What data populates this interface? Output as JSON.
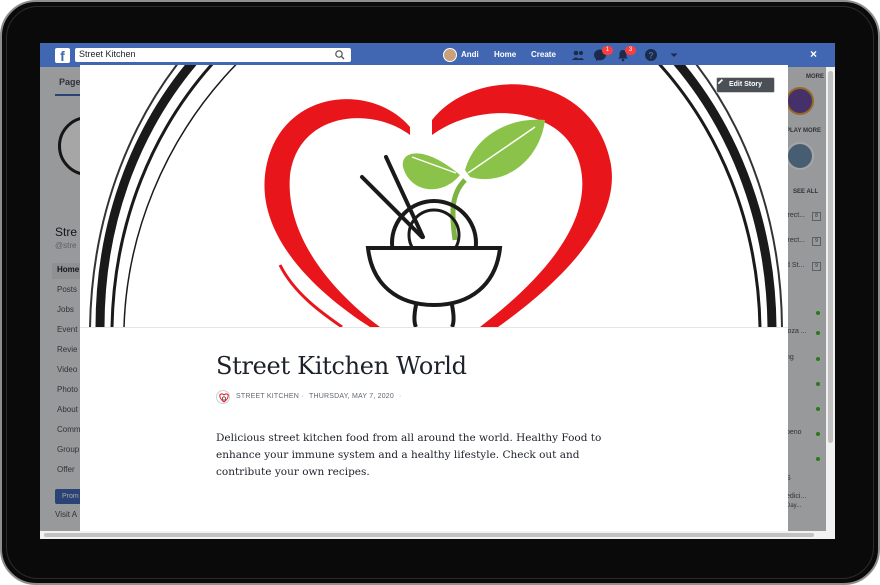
{
  "facebook": {
    "search_value": "Street Kitchen",
    "user_name": "Andi",
    "nav_home": "Home",
    "nav_create": "Create",
    "messages_badge": "1",
    "notifications_badge": "3",
    "close_label": "×"
  },
  "background_page": {
    "tab_label": "Page",
    "page_name": "Stre",
    "page_handle": "@stre",
    "nav_items": [
      "Home",
      "Posts",
      "Jobs",
      "Event",
      "Revie",
      "Video",
      "Photo",
      "About",
      "Comm",
      "Group",
      "Offer"
    ],
    "promote_label": "Prom",
    "visit_label": "Visit A",
    "right_more_1": "MORE",
    "right_more_2": "PLAY MORE",
    "right_see_all": "SEE ALL",
    "right_rows": [
      "irect...",
      "irect...",
      "d St...",
      "loza ...",
      "ng",
      "peno",
      "S",
      "edici...",
      "Day..."
    ],
    "right_counts": [
      "8",
      "9",
      "9"
    ]
  },
  "modal": {
    "edit_story_label": "Edit Story",
    "title": "Street Kitchen World",
    "author": "STREET KITCHEN",
    "separator": "·",
    "date": "THURSDAY, MAY 7, 2020",
    "body": "Delicious street kitchen food from all around the world. Healthy Food to enhance your immune system and a healthy lifestyle. Check out and contribute your own recipes."
  },
  "colors": {
    "fb_blue": "#4267b2",
    "heart_red": "#e8161b",
    "leaf_green": "#8bc34a",
    "ink": "#1a1a1a"
  },
  "icons": {
    "search": "search-icon",
    "friends": "friends-icon",
    "messenger": "messenger-icon",
    "notifications": "bell-icon",
    "help": "help-icon",
    "dropdown": "chevron-down-icon",
    "pencil": "pencil-icon"
  }
}
